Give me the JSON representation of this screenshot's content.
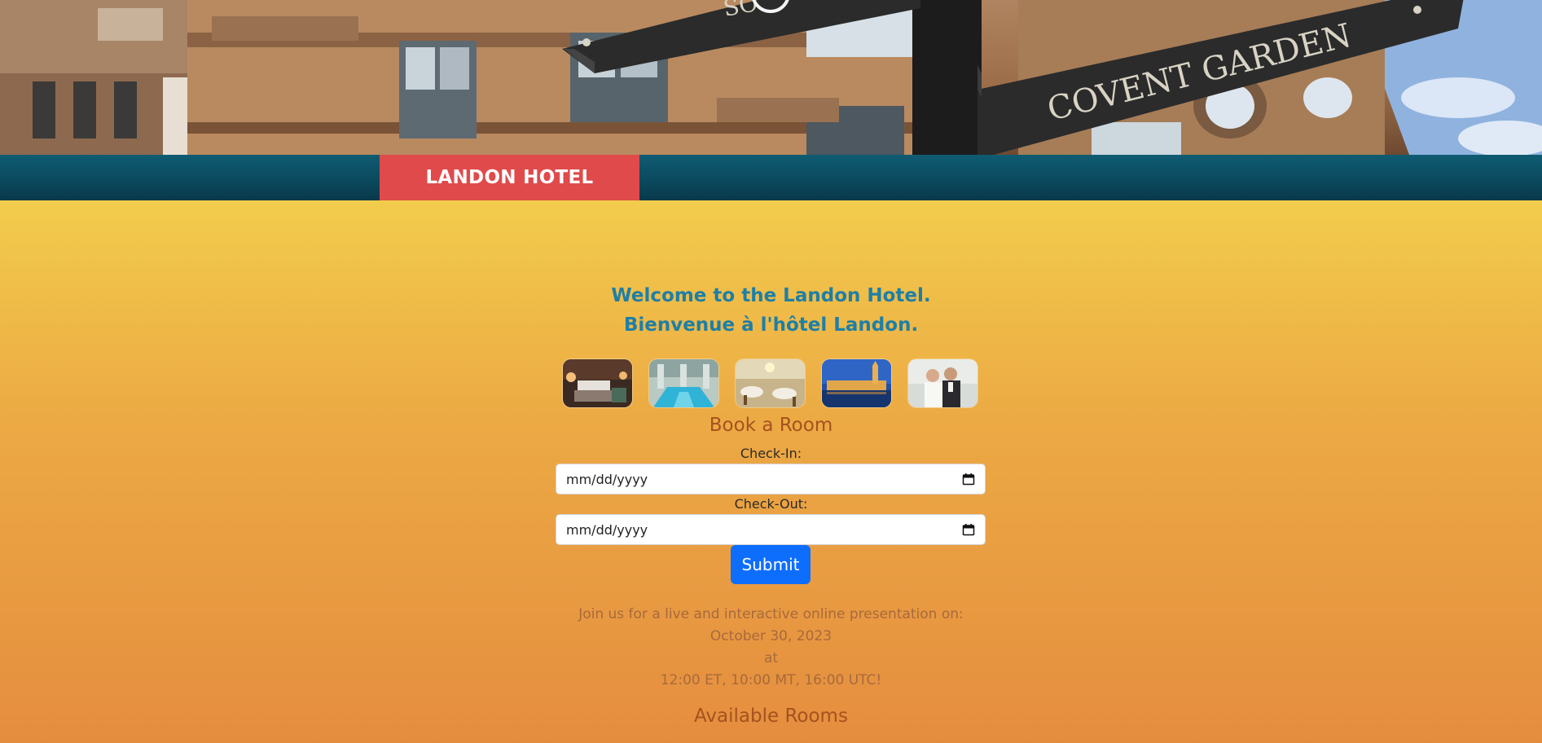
{
  "header": {
    "brand": "LANDON HOTEL",
    "hero_sign_text": "COVENT GARDEN",
    "hero_sign_partial": "SO"
  },
  "welcome": {
    "line1": "Welcome to the Landon Hotel.",
    "line2": "Bienvenue à l'hôtel Landon."
  },
  "gallery": {
    "images": [
      {
        "name": "guest-room"
      },
      {
        "name": "indoor-pool"
      },
      {
        "name": "dining-room"
      },
      {
        "name": "westminster-night"
      },
      {
        "name": "wedding-couple"
      }
    ]
  },
  "booking": {
    "title": "Book a Room",
    "checkin_label": "Check-In:",
    "checkin_placeholder": "mm/dd/yyyy",
    "checkout_label": "Check-Out:",
    "checkout_placeholder": "mm/dd/yyyy",
    "submit_label": "Submit",
    "calendar_icon": "calendar-icon"
  },
  "presentation": {
    "line1": "Join us for a live and interactive online presentation on:",
    "line2": "October 30, 2023",
    "line3": "at",
    "line4": "12:00 ET, 10:00 MT, 16:00 UTC!"
  },
  "rooms": {
    "title": "Available Rooms"
  },
  "colors": {
    "brand_red": "#e04a4b",
    "nav_teal": "#0b4a5e",
    "welcome_blue": "#1e7fa6",
    "submit_blue": "#0d6efd",
    "heading_brown": "#a5521f"
  }
}
